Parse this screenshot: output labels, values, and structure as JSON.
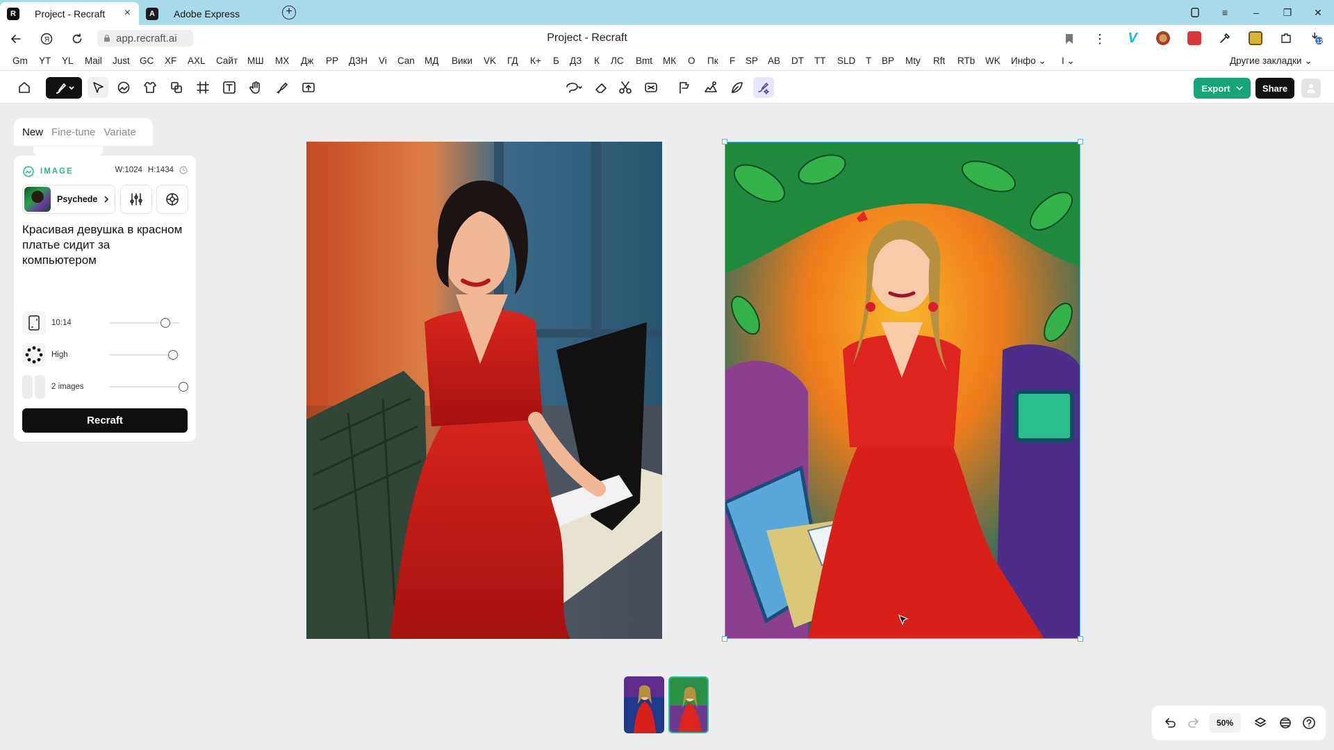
{
  "browser": {
    "tabs": [
      {
        "label": "Project - Recraft",
        "favicon": "R"
      },
      {
        "label": "Adobe Express",
        "favicon": "A"
      }
    ],
    "url": "app.recraft.ai",
    "page_title": "Project - Recraft",
    "extension_badge": "12"
  },
  "bookmarks": {
    "items": [
      "Gm",
      "YT",
      "YL",
      "Mail",
      "Just",
      "GC",
      "XF",
      "AXL",
      "Сайт",
      "МШ",
      "MX",
      "Дж",
      "PP",
      "ДЗН",
      "Vi",
      "Can",
      "МД",
      "Вики",
      "VK",
      "ГД",
      "К+",
      "Б",
      "ДЗ",
      "К",
      "ЛС",
      "Bmt",
      "МК",
      "О",
      "Пк",
      "F",
      "SP",
      "AB",
      "DT",
      "TT",
      "SLD",
      "T",
      "BP",
      "Mty",
      "Rft",
      "RTb",
      "WK",
      "Инфо",
      "I"
    ],
    "other": "Другие закладки"
  },
  "toolbar": {
    "export_label": "Export",
    "share_label": "Share"
  },
  "mode_tabs": [
    "New",
    "Fine-tune",
    "Variate"
  ],
  "panel": {
    "section_label": "IMAGE",
    "width_label": "W:",
    "width_value": "1024",
    "height_label": "H:",
    "height_value": "1434",
    "style_name": "Psychede",
    "prompt": "Красивая девушка в красном платье сидит за компьютером",
    "aspect_ratio": "10:14",
    "quality": "High",
    "image_count": "2 images",
    "submit_label": "Recraft"
  },
  "zoom": "50%",
  "colors": {
    "export_green": "#16a57b",
    "selection_blue": "#5ab6e0",
    "accent_teal": "#2db58a",
    "tab_strip": "#a7dbe9"
  }
}
